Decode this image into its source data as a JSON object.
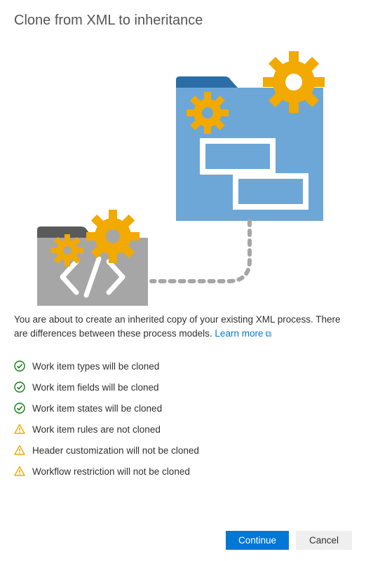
{
  "dialog": {
    "title": "Clone from XML to inheritance",
    "description_prefix": "You are about to create an inherited copy of your existing XML process. There are differences between these process models. ",
    "learn_more_label": "Learn more"
  },
  "items": [
    {
      "icon": "success",
      "label": "Work item types will be cloned"
    },
    {
      "icon": "success",
      "label": "Work item fields will be cloned"
    },
    {
      "icon": "success",
      "label": "Work item states will be cloned"
    },
    {
      "icon": "warning",
      "label": "Work item rules are not cloned"
    },
    {
      "icon": "warning",
      "label": "Header customization will not be cloned"
    },
    {
      "icon": "warning",
      "label": "Workflow restriction will not be cloned"
    }
  ],
  "buttons": {
    "continue": "Continue",
    "cancel": "Cancel"
  },
  "colors": {
    "primary": "#0078d4",
    "success": "#107c10",
    "warning": "#f2a900"
  }
}
